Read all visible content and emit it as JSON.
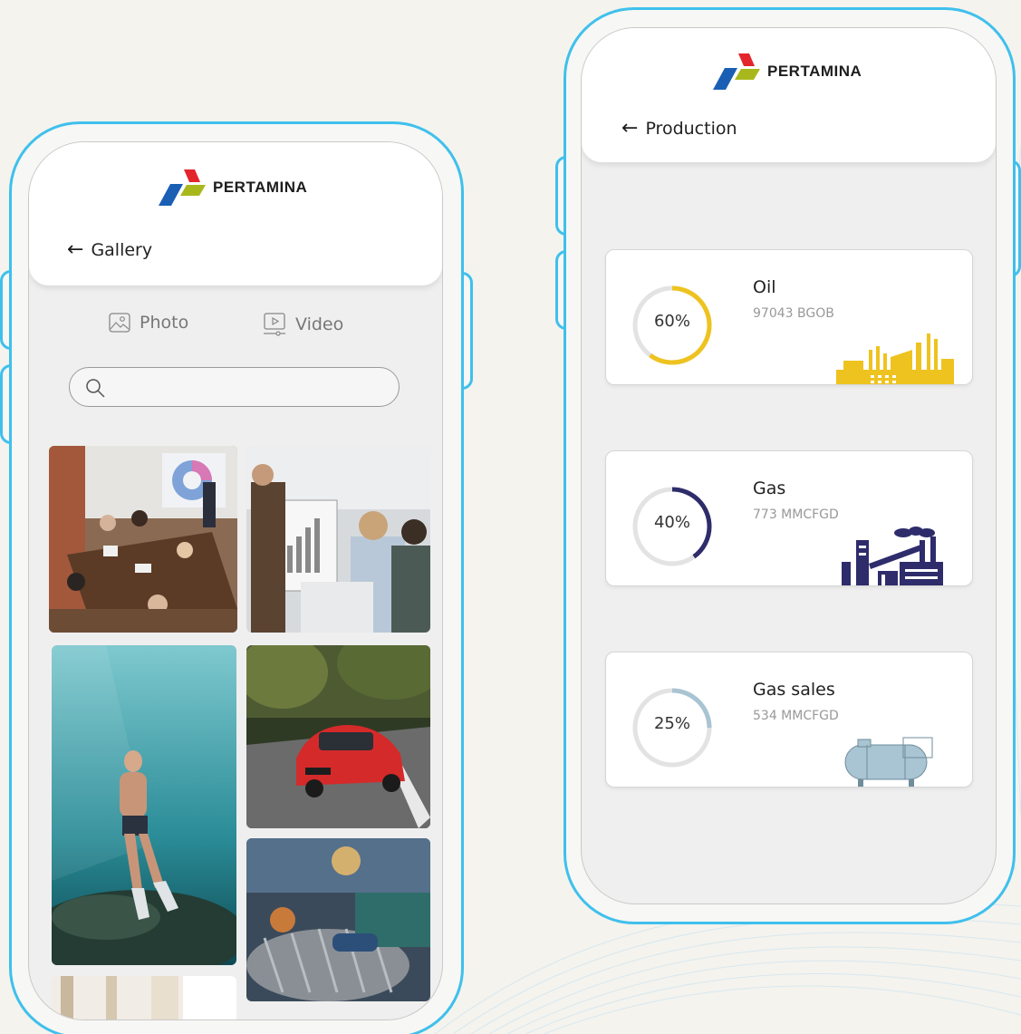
{
  "brand": {
    "name": "PERTAMINA",
    "colors": {
      "red": "#e3262b",
      "blue": "#1a5fb4",
      "green": "#a8b81c",
      "frame": "#3fc0ec"
    }
  },
  "gallery_screen": {
    "back_icon": "arrow-left-icon",
    "title": "Gallery",
    "tabs": [
      {
        "label": "Photo",
        "icon": "image-icon"
      },
      {
        "label": "Video",
        "icon": "video-icon"
      }
    ],
    "search": {
      "placeholder": "",
      "icon": "search-icon"
    },
    "photos": [
      {
        "subject": "meeting-room"
      },
      {
        "subject": "presentation"
      },
      {
        "subject": "diver"
      },
      {
        "subject": "red-car"
      },
      {
        "subject": "welding"
      },
      {
        "subject": "interior"
      }
    ]
  },
  "production_screen": {
    "back_icon": "arrow-left-icon",
    "title": "Production",
    "cards": [
      {
        "name": "Oil",
        "value": "97043 BGOB",
        "percent_label": "60%",
        "percent": 60,
        "color": "#eec31f",
        "illustration": "refinery-icon"
      },
      {
        "name": "Gas",
        "value": "773 MMCFGD",
        "percent_label": "40%",
        "percent": 40,
        "color": "#2e2c6b",
        "illustration": "gas-plant-icon"
      },
      {
        "name": "Gas sales",
        "value": "534 MMCFGD",
        "percent_label": "25%",
        "percent": 25,
        "color": "#a9c4d2",
        "illustration": "storage-tank-icon"
      }
    ]
  }
}
